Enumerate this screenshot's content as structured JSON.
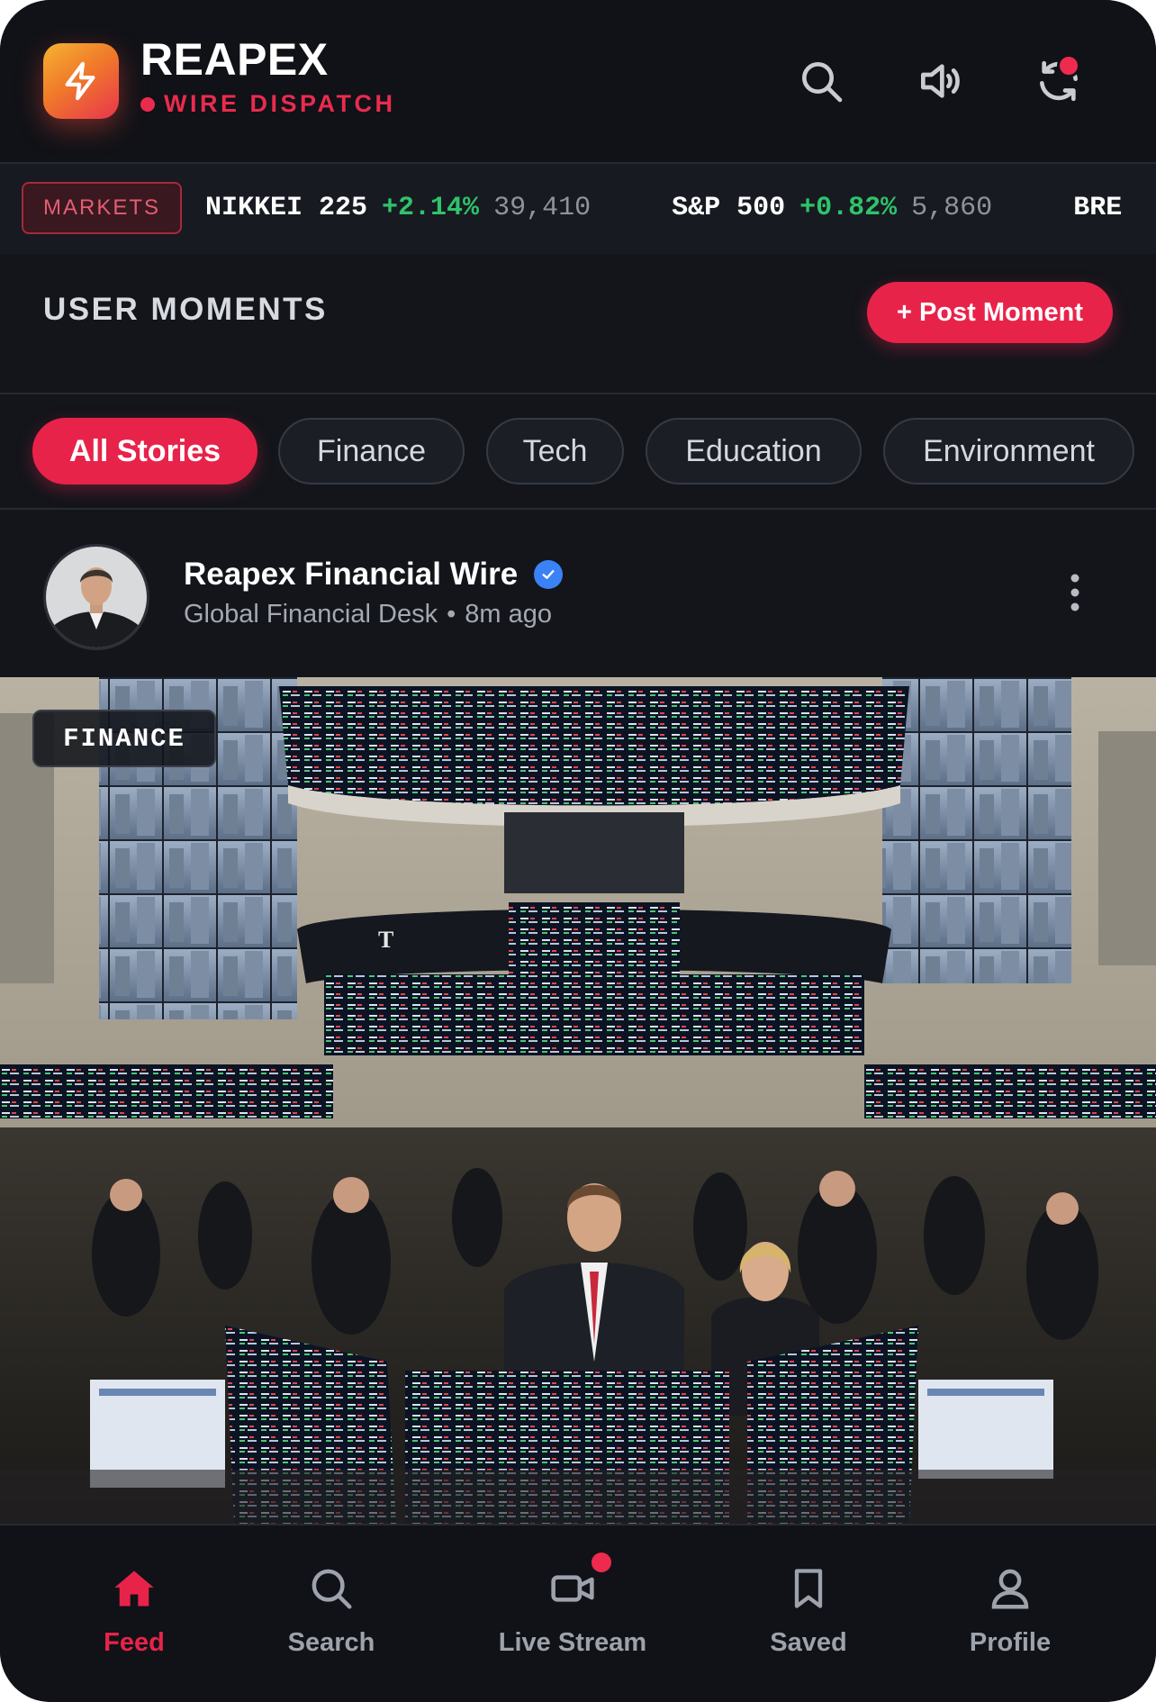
{
  "app": {
    "name": "REAPEX",
    "subtitle": "WIRE DISPATCH"
  },
  "header_icons": [
    "search-icon",
    "volume-icon",
    "refresh-icon"
  ],
  "ticker": {
    "badge": "MARKETS",
    "items": [
      {
        "name": "NIKKEI 225",
        "change": "+2.14%",
        "value": "39,410"
      },
      {
        "name": "S&P 500",
        "change": "+0.82%",
        "value": "5,860"
      },
      {
        "name": "BRE",
        "change": "",
        "value": ""
      }
    ]
  },
  "section": {
    "title": "USER MOMENTS",
    "post_button": "+ Post Moment"
  },
  "filters": {
    "active": "All Stories",
    "items": [
      "All Stories",
      "Finance",
      "Tech",
      "Education",
      "Environment"
    ]
  },
  "post": {
    "author": "Reapex Financial Wire",
    "verified": true,
    "desk": "Global Financial Desk",
    "separator": "•",
    "time": "8m ago",
    "category": "FINANCE"
  },
  "bottom_nav": {
    "active": "Feed",
    "items": [
      {
        "label": "Feed",
        "icon": "home-icon"
      },
      {
        "label": "Search",
        "icon": "search-icon"
      },
      {
        "label": "Live Stream",
        "icon": "video-icon"
      },
      {
        "label": "Saved",
        "icon": "bookmark-icon"
      },
      {
        "label": "Profile",
        "icon": "user-icon"
      }
    ]
  },
  "colors": {
    "accent": "#e8234a",
    "background": "#13151b",
    "ticker_positive": "#2fc36a",
    "verified": "#3b82f6"
  }
}
